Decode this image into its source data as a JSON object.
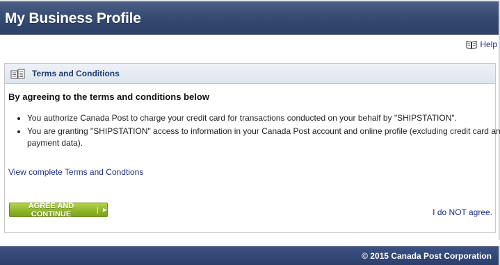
{
  "header": {
    "title": "My Business Profile"
  },
  "help": {
    "label": "Help"
  },
  "panel": {
    "title": "Terms and Conditions",
    "heading": "By agreeing to the terms and conditions below",
    "items": [
      "You authorize Canada Post to charge your credit card for transactions conducted on your behalf by \"SHIPSTATION\".",
      "You are granting \"SHIPSTATION\" access to information in your Canada Post account and online profile (excluding credit card and payment data)."
    ],
    "view_terms_label": "View complete Terms and Condtions",
    "agree_button_label": "AGREE AND CONTINUE",
    "not_agree_label": "I do NOT agree."
  },
  "footer": {
    "copyright": "© 2015 Canada Post Corporation"
  },
  "colors": {
    "header_bg": "#34496f",
    "link": "#1a2e8a",
    "agree_button": "#8fb52b",
    "footer_bg": "#34477a"
  },
  "icons": {
    "help": "book-icon",
    "panel": "document-icon",
    "button_arrow": "play-arrow-icon"
  }
}
